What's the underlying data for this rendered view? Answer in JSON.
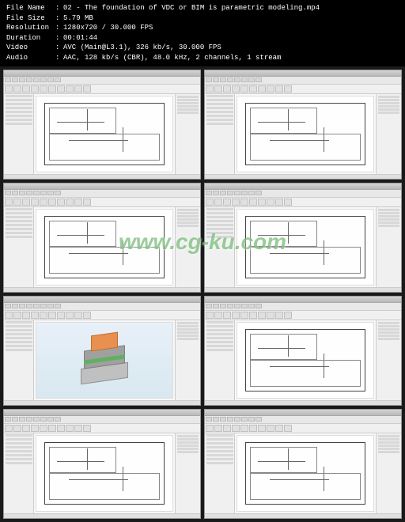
{
  "header": {
    "labels": {
      "filename": "File Name",
      "filesize": "File Size",
      "resolution": "Resolution",
      "duration": "Duration",
      "video": "Video",
      "audio": "Audio"
    },
    "separator": ":",
    "values": {
      "filename": "02 - The foundation of VDC or BIM is parametric modeling.mp4",
      "filesize": "5.79 MB",
      "resolution": "1280x720 / 30.000 FPS",
      "duration": "00:01:44",
      "video": "AVC (Main@L3.1), 326 kb/s, 30.000 FPS",
      "audio": "AAC, 128 kb/s (CBR), 48.0 kHz, 2 channels, 1 stream"
    }
  },
  "watermark": "www.cg-ku.com",
  "thumbnails": [
    {
      "type": "floorplan"
    },
    {
      "type": "floorplan"
    },
    {
      "type": "floorplan"
    },
    {
      "type": "floorplan"
    },
    {
      "type": "3d-model"
    },
    {
      "type": "floorplan"
    },
    {
      "type": "floorplan"
    },
    {
      "type": "floorplan"
    }
  ]
}
